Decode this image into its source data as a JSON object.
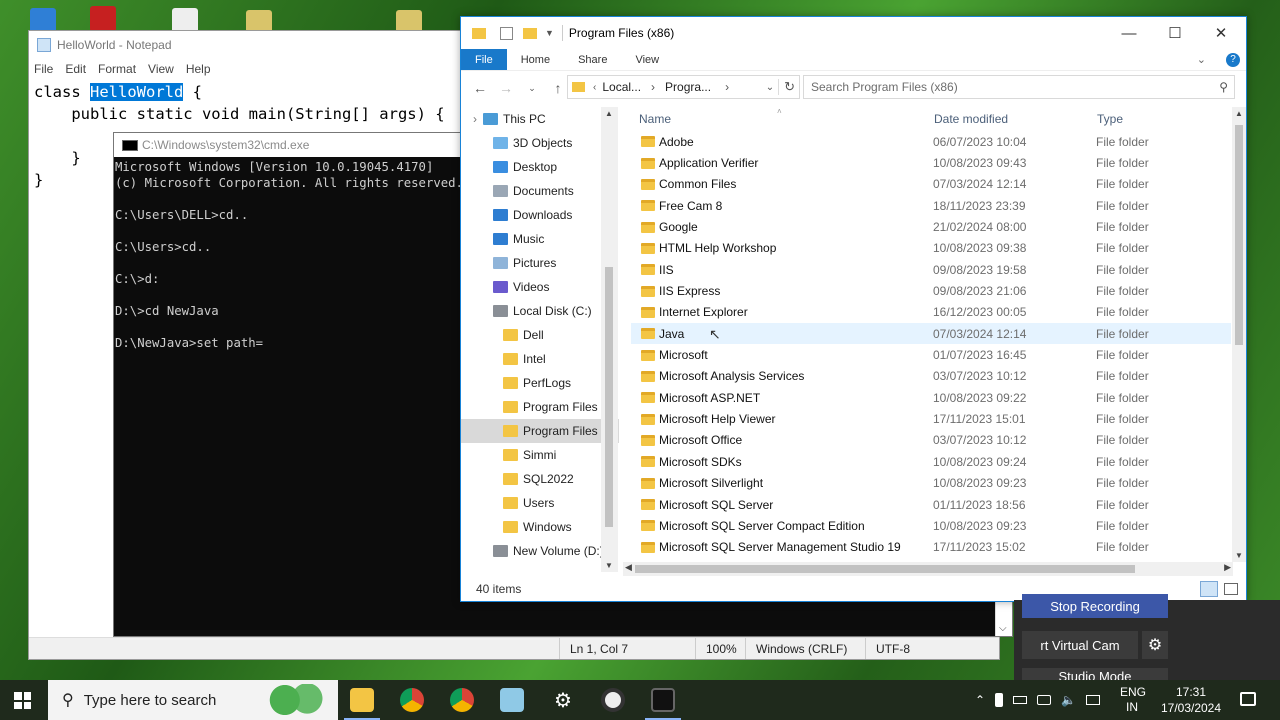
{
  "notepad": {
    "title": "HelloWorld - Notepad",
    "menu": [
      "File",
      "Edit",
      "Format",
      "View",
      "Help"
    ],
    "code": {
      "l1_pre": "class ",
      "l1_sel": "HelloWorld",
      "l1_post": " {",
      "l2": "    public static void main(String[] args) {",
      "l4": "    }",
      "l5": "}"
    },
    "status": {
      "pos": "Ln 1, Col 7",
      "zoom": "100%",
      "eol": "Windows (CRLF)",
      "enc": "UTF-8"
    }
  },
  "cmd": {
    "title": "C:\\Windows\\system32\\cmd.exe",
    "lines": [
      "Microsoft Windows [Version 10.0.19045.4170]",
      "(c) Microsoft Corporation. All rights reserved.",
      "",
      "C:\\Users\\DELL>cd..",
      "",
      "C:\\Users>cd..",
      "",
      "C:\\>d:",
      "",
      "D:\\>cd NewJava",
      "",
      "D:\\NewJava>set path="
    ]
  },
  "explorer": {
    "title": "Program Files (x86)",
    "tabs": {
      "file": "File",
      "home": "Home",
      "share": "Share",
      "view": "View"
    },
    "breadcrumb": [
      "Local...",
      "Progra..."
    ],
    "search_placeholder": "Search Program Files (x86)",
    "nav": [
      {
        "label": "This PC",
        "indent": 0,
        "icon": "this-pc-icon"
      },
      {
        "label": "3D Objects",
        "indent": 1,
        "icon": "3d-objects-icon"
      },
      {
        "label": "Desktop",
        "indent": 1,
        "icon": "desktop-icon"
      },
      {
        "label": "Documents",
        "indent": 1,
        "icon": "documents-icon"
      },
      {
        "label": "Downloads",
        "indent": 1,
        "icon": "downloads-icon"
      },
      {
        "label": "Music",
        "indent": 1,
        "icon": "music-icon"
      },
      {
        "label": "Pictures",
        "indent": 1,
        "icon": "pictures-icon"
      },
      {
        "label": "Videos",
        "indent": 1,
        "icon": "videos-icon"
      },
      {
        "label": "Local Disk (C:)",
        "indent": 1,
        "icon": "drive-icon"
      },
      {
        "label": "Dell",
        "indent": 2,
        "icon": "folder-icon"
      },
      {
        "label": "Intel",
        "indent": 2,
        "icon": "folder-icon"
      },
      {
        "label": "PerfLogs",
        "indent": 2,
        "icon": "folder-icon"
      },
      {
        "label": "Program Files",
        "indent": 2,
        "icon": "folder-icon"
      },
      {
        "label": "Program Files (",
        "indent": 2,
        "icon": "folder-icon",
        "selected": true
      },
      {
        "label": "Simmi",
        "indent": 2,
        "icon": "folder-icon"
      },
      {
        "label": "SQL2022",
        "indent": 2,
        "icon": "folder-icon"
      },
      {
        "label": "Users",
        "indent": 2,
        "icon": "folder-icon"
      },
      {
        "label": "Windows",
        "indent": 2,
        "icon": "folder-icon"
      },
      {
        "label": "New Volume (D:)",
        "indent": 1,
        "icon": "drive-icon"
      }
    ],
    "columns": {
      "name": "Name",
      "date": "Date modified",
      "type": "Type"
    },
    "rows": [
      {
        "name": "Adobe",
        "date": "06/07/2023 10:04",
        "type": "File folder"
      },
      {
        "name": "Application Verifier",
        "date": "10/08/2023 09:43",
        "type": "File folder"
      },
      {
        "name": "Common Files",
        "date": "07/03/2024 12:14",
        "type": "File folder"
      },
      {
        "name": "Free Cam 8",
        "date": "18/11/2023 23:39",
        "type": "File folder"
      },
      {
        "name": "Google",
        "date": "21/02/2024 08:00",
        "type": "File folder"
      },
      {
        "name": "HTML Help Workshop",
        "date": "10/08/2023 09:38",
        "type": "File folder"
      },
      {
        "name": "IIS",
        "date": "09/08/2023 19:58",
        "type": "File folder"
      },
      {
        "name": "IIS Express",
        "date": "09/08/2023 21:06",
        "type": "File folder"
      },
      {
        "name": "Internet Explorer",
        "date": "16/12/2023 00:05",
        "type": "File folder"
      },
      {
        "name": "Java",
        "date": "07/03/2024 12:14",
        "type": "File folder",
        "hover": true
      },
      {
        "name": "Microsoft",
        "date": "01/07/2023 16:45",
        "type": "File folder"
      },
      {
        "name": "Microsoft Analysis Services",
        "date": "03/07/2023 10:12",
        "type": "File folder"
      },
      {
        "name": "Microsoft ASP.NET",
        "date": "10/08/2023 09:22",
        "type": "File folder"
      },
      {
        "name": "Microsoft Help Viewer",
        "date": "17/11/2023 15:01",
        "type": "File folder"
      },
      {
        "name": "Microsoft Office",
        "date": "03/07/2023 10:12",
        "type": "File folder"
      },
      {
        "name": "Microsoft SDKs",
        "date": "10/08/2023 09:24",
        "type": "File folder"
      },
      {
        "name": "Microsoft Silverlight",
        "date": "10/08/2023 09:23",
        "type": "File folder"
      },
      {
        "name": "Microsoft SQL Server",
        "date": "01/11/2023 18:56",
        "type": "File folder"
      },
      {
        "name": "Microsoft SQL Server Compact Edition",
        "date": "10/08/2023 09:23",
        "type": "File folder"
      },
      {
        "name": "Microsoft SQL Server Management Studio 19",
        "date": "17/11/2023 15:02",
        "type": "File folder"
      }
    ],
    "status": "40 items"
  },
  "obs": {
    "stop_recording": "Stop Recording",
    "virtual_cam": "rt Virtual Cam",
    "studio_mode": "Studio Mode"
  },
  "taskbar": {
    "search_placeholder": "Type here to search",
    "lang1": "ENG",
    "lang2": "IN",
    "time": "17:31",
    "date": "17/03/2024"
  }
}
